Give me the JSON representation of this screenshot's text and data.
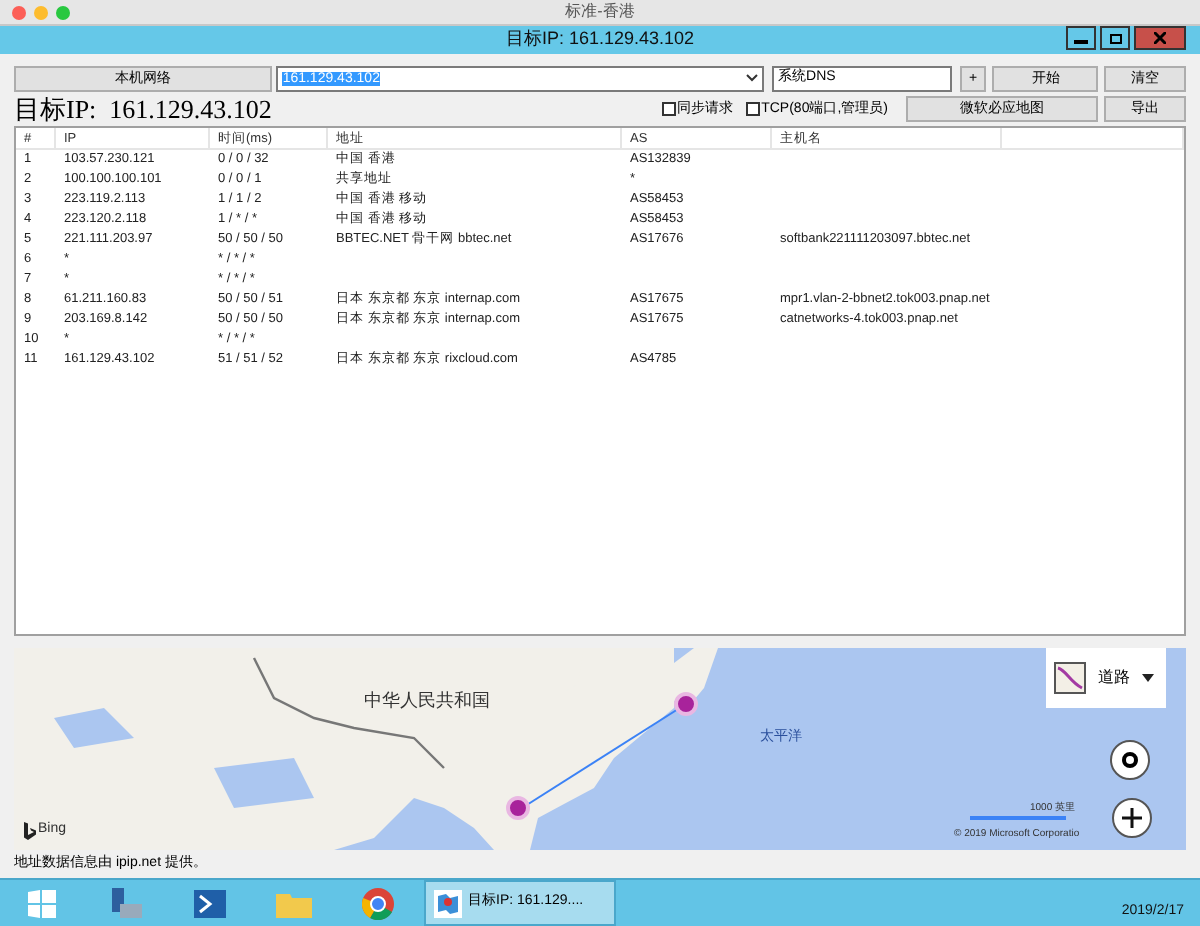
{
  "window": {
    "title": "标准-香港"
  },
  "app_bar": {
    "title": "目标IP: 161.129.43.102"
  },
  "toolbar": {
    "local_network_button": "本机网络",
    "target_field": {
      "value": "161.129.43.102"
    },
    "dns_select": {
      "value": "系统DNS"
    },
    "add_button": "+",
    "start_button": "开始",
    "clear_button": "清空"
  },
  "target_heading": "目标IP:  161.129.43.102",
  "options": [
    {
      "label": "同步请求",
      "checked": false
    },
    {
      "label": "TCP(80端口,管理员)",
      "checked": false
    }
  ],
  "map_button": "微软必应地图",
  "export_button": "导出",
  "table": {
    "columns": [
      "#",
      "IP",
      "时间(ms)",
      "地址",
      "AS",
      "主机名"
    ],
    "rows": [
      {
        "no": "1",
        "ip": "103.57.230.121",
        "time": "0 / 0 / 32",
        "location": "中国 香港",
        "as": "AS132839"
      },
      {
        "no": "2",
        "ip": "100.100.100.101",
        "time": "0 / 0 / 1",
        "location": "共享地址",
        "as": "*"
      },
      {
        "no": "3",
        "ip": "223.119.2.113",
        "time": "1 / 1 / 2",
        "location": "中国 香港 移动",
        "as": "AS58453"
      },
      {
        "no": "4",
        "ip": "223.120.2.118",
        "time": "1 / * / *",
        "location": "中国 香港 移动",
        "as": "AS58453"
      },
      {
        "no": "5",
        "ip": "221.111.203.97",
        "time": "50 / 50 / 50",
        "location": "BBTEC.NET 骨干网 bbtec.net",
        "as": "AS17676",
        "hostname": "softbank221111203097.bbtec.net"
      },
      {
        "no": "6",
        "ip": "*",
        "time": "* / * / *"
      },
      {
        "no": "7",
        "ip": "*",
        "time": "* / * / *"
      },
      {
        "no": "8",
        "ip": "61.211.160.83",
        "time": "50 / 50 / 51",
        "location": "日本 东京都 东京 internap.com",
        "as": "AS17675",
        "hostname": "mpr1.vlan-2-bbnet2.tok003.pnap.net"
      },
      {
        "no": "9",
        "ip": "203.169.8.142",
        "time": "50 / 50 / 50",
        "location": "日本 东京都 东京 internap.com",
        "as": "AS17675",
        "hostname": "catnetworks-4.tok003.pnap.net"
      },
      {
        "no": "10",
        "ip": "*",
        "time": "* / * / *"
      },
      {
        "no": "11",
        "ip": "161.129.43.102",
        "time": "51 / 51 / 52",
        "location": "日本 东京都 东京 rixcloud.com",
        "as": "AS4785"
      }
    ]
  },
  "map": {
    "map_type": "道路",
    "country_label": "中华人民共和国",
    "ocean_label": "太平洋",
    "attribution": "Bing",
    "scale": "1000 英里",
    "copyright": "© 2019 Microsoft Corporatio"
  },
  "footer": "地址数据信息由 ipip.net 提供。",
  "taskbar": {
    "active_window": "目标IP: 161.129....",
    "clock": "2019/2/17"
  }
}
